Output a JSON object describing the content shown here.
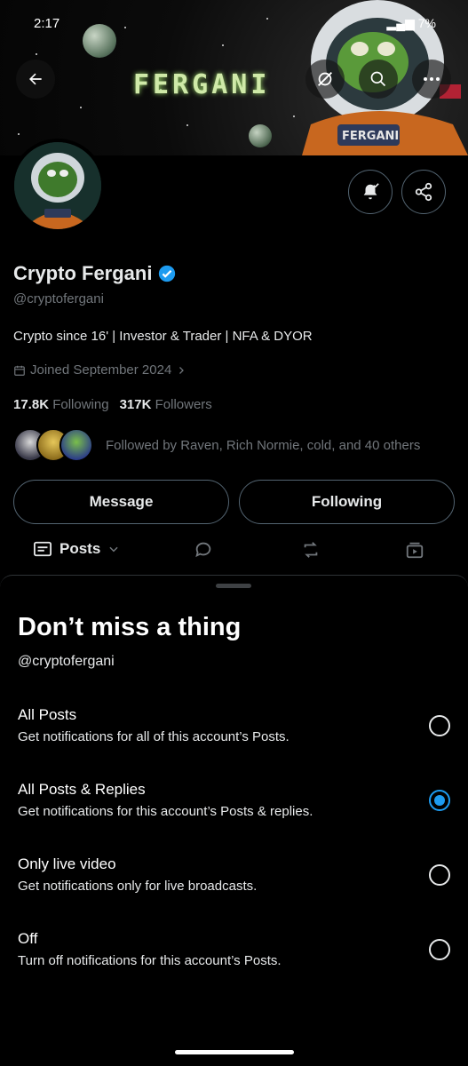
{
  "status_bar": {
    "time": "2:17",
    "battery": "7%"
  },
  "banner": {
    "text": "FERGANI",
    "suit_label": "FERGANI"
  },
  "profile": {
    "name": "Crypto Fergani",
    "handle": "@cryptofergani",
    "bio": "Crypto since 16' | Investor & Trader | NFA & DYOR",
    "joined": "Joined September 2024",
    "following_count": "17.8K",
    "following_label": "Following",
    "followers_count": "317K",
    "followers_label": "Followers",
    "followed_by": "Followed by Raven, Rich Normie, cold, and 40 others"
  },
  "actions": {
    "message_label": "Message",
    "following_label": "Following"
  },
  "tabs": {
    "posts_label": "Posts"
  },
  "sheet": {
    "title": "Don’t miss a thing",
    "handle": "@cryptofergani",
    "options": [
      {
        "title": "All Posts",
        "subtitle": "Get notifications for all of this account’s Posts.",
        "selected": false
      },
      {
        "title": "All Posts & Replies",
        "subtitle": "Get notifications for this account’s Posts & replies.",
        "selected": true
      },
      {
        "title": "Only live video",
        "subtitle": "Get notifications only for live broadcasts.",
        "selected": false
      },
      {
        "title": "Off",
        "subtitle": "Turn off notifications for this account’s Posts.",
        "selected": false
      }
    ]
  },
  "colors": {
    "accent": "#1d9bf0",
    "muted": "#71767b",
    "border": "#536471"
  }
}
